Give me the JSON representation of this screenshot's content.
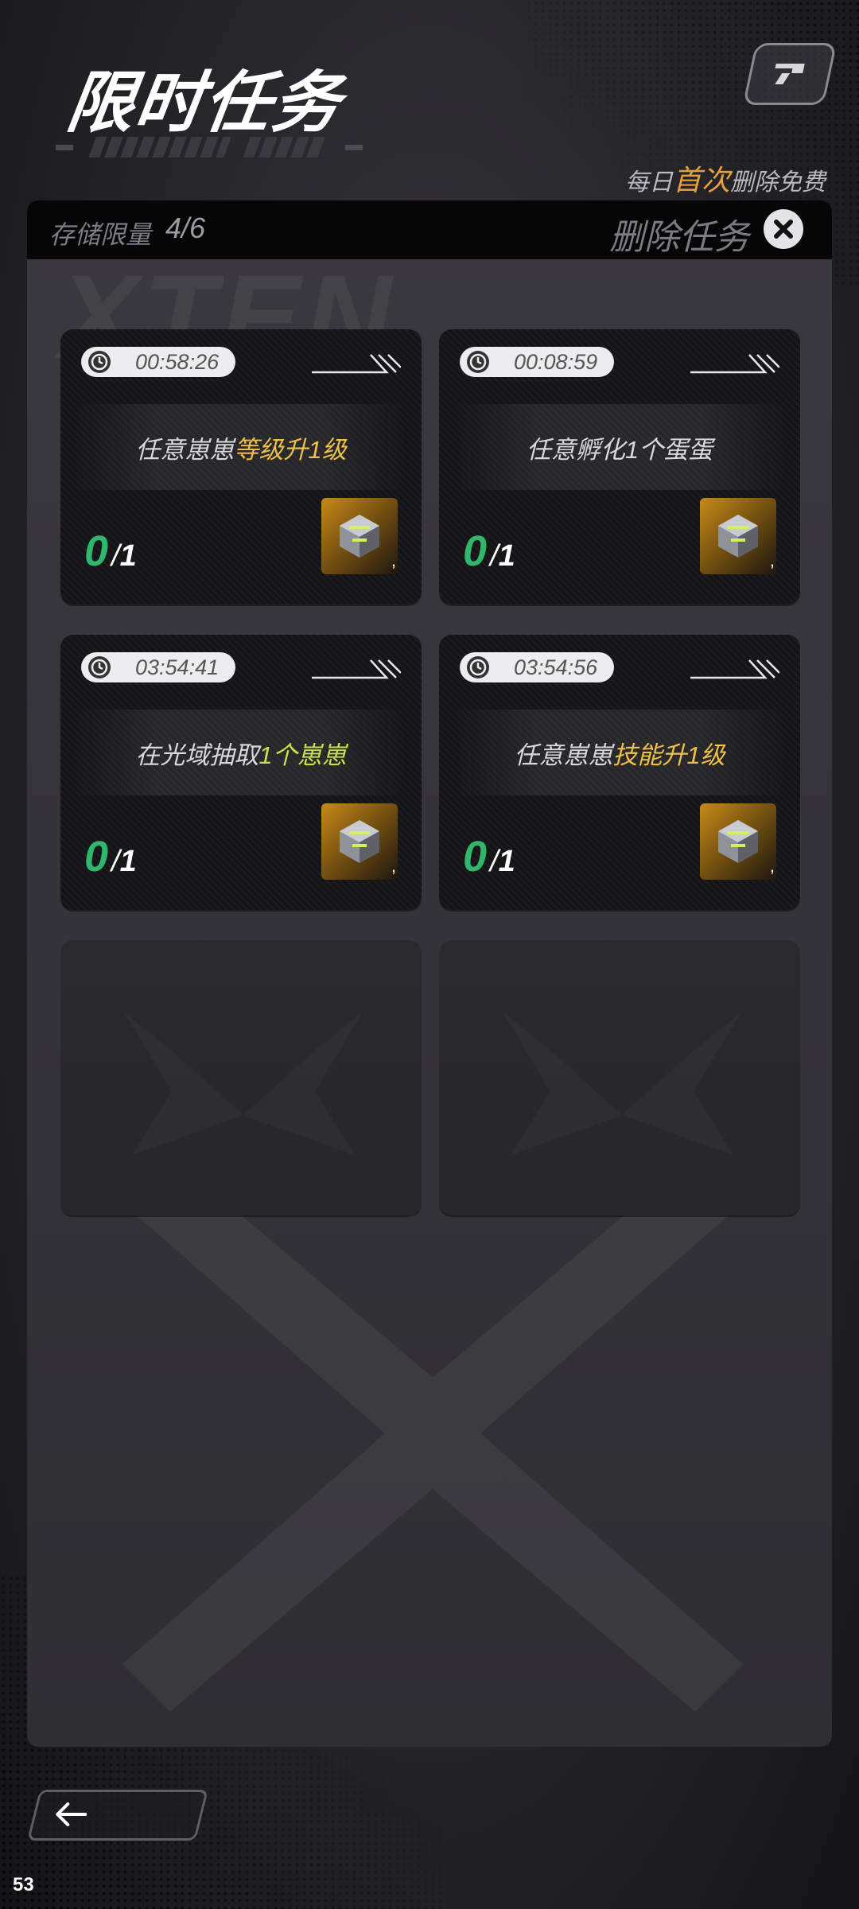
{
  "header": {
    "title": "限时任务",
    "free_note_prefix": "每日",
    "free_note_highlight": "首次",
    "free_note_suffix": "删除免费"
  },
  "panel": {
    "storage_label": "存储限量",
    "storage_value": "4/6",
    "delete_label": "删除任务"
  },
  "tasks": [
    {
      "timer": "00:58:26",
      "text_plain": "任意崽崽",
      "text_highlight": "等级升1级",
      "text_tail": "",
      "highlight_color": "yellow",
      "progress_current": "0",
      "progress_sep": "/",
      "progress_total": "1"
    },
    {
      "timer": "00:08:59",
      "text_plain": "任意孵化1个蛋蛋",
      "text_highlight": "",
      "text_tail": "",
      "highlight_color": "",
      "progress_current": "0",
      "progress_sep": "/",
      "progress_total": "1"
    },
    {
      "timer": "03:54:41",
      "text_plain": "在光域抽取",
      "text_highlight": "1个崽崽",
      "text_tail": "",
      "highlight_color": "green",
      "progress_current": "0",
      "progress_sep": "/",
      "progress_total": "1"
    },
    {
      "timer": "03:54:56",
      "text_plain": "任意崽崽",
      "text_highlight": "技能升1级",
      "text_tail": "",
      "highlight_color": "yellow",
      "progress_current": "0",
      "progress_sep": "/",
      "progress_total": "1"
    }
  ],
  "reward_comma": ",",
  "page_number": "53",
  "icons": {
    "help": "help-icon",
    "close": "close-icon",
    "clock": "clock-icon",
    "reward": "reward-cube-icon",
    "back": "back-arrow-icon"
  },
  "colors": {
    "progress_current": "#2fb86c",
    "highlight_yellow": "#f0c14a",
    "highlight_green": "#c8e04a",
    "free_highlight": "#e8a13a"
  }
}
